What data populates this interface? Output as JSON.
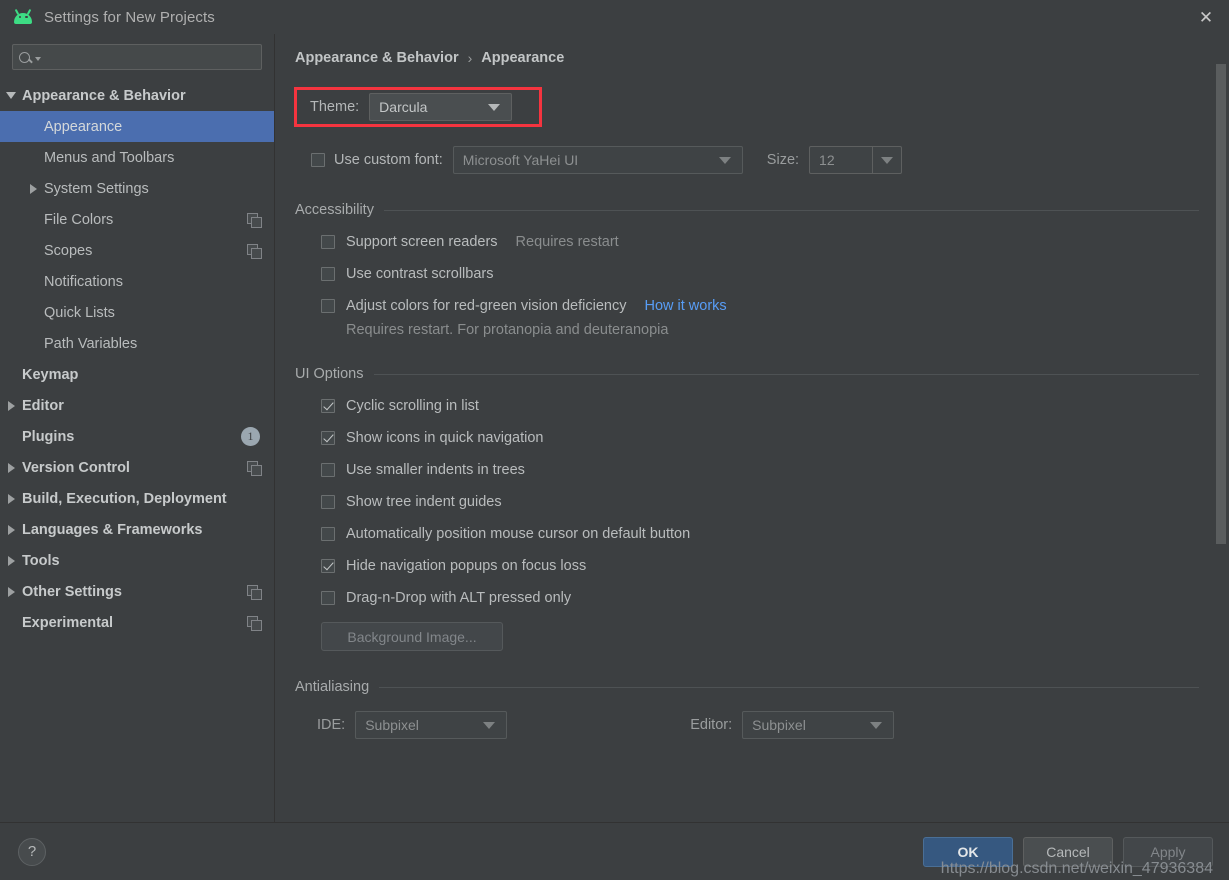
{
  "window": {
    "title": "Settings for New Projects",
    "app_icon": "android-robot-icon",
    "close_icon": "close-icon",
    "accent_selection": "#4b6eaf",
    "annotation_color": "#f5343f",
    "link_color": "#589df6"
  },
  "search": {
    "value": "",
    "placeholder": "",
    "icon": "search-icon"
  },
  "sidebar": {
    "items": [
      {
        "label": "Appearance & Behavior",
        "arrow": "expanded",
        "bold": true,
        "indent": 0,
        "selected": false,
        "icon": "",
        "badge": ""
      },
      {
        "label": "Appearance",
        "arrow": "none",
        "bold": false,
        "indent": 1,
        "selected": true,
        "icon": "",
        "badge": ""
      },
      {
        "label": "Menus and Toolbars",
        "arrow": "none",
        "bold": false,
        "indent": 1,
        "selected": false,
        "icon": "",
        "badge": ""
      },
      {
        "label": "System Settings",
        "arrow": "collapsed",
        "bold": false,
        "indent": 1,
        "selected": false,
        "icon": "",
        "badge": ""
      },
      {
        "label": "File Colors",
        "arrow": "none",
        "bold": false,
        "indent": 1,
        "selected": false,
        "icon": "copy-icon",
        "badge": ""
      },
      {
        "label": "Scopes",
        "arrow": "none",
        "bold": false,
        "indent": 1,
        "selected": false,
        "icon": "copy-icon",
        "badge": ""
      },
      {
        "label": "Notifications",
        "arrow": "none",
        "bold": false,
        "indent": 1,
        "selected": false,
        "icon": "",
        "badge": ""
      },
      {
        "label": "Quick Lists",
        "arrow": "none",
        "bold": false,
        "indent": 1,
        "selected": false,
        "icon": "",
        "badge": ""
      },
      {
        "label": "Path Variables",
        "arrow": "none",
        "bold": false,
        "indent": 1,
        "selected": false,
        "icon": "",
        "badge": ""
      },
      {
        "label": "Keymap",
        "arrow": "none",
        "bold": true,
        "indent": 0,
        "selected": false,
        "icon": "",
        "badge": ""
      },
      {
        "label": "Editor",
        "arrow": "collapsed",
        "bold": true,
        "indent": 0,
        "selected": false,
        "icon": "",
        "badge": ""
      },
      {
        "label": "Plugins",
        "arrow": "none",
        "bold": true,
        "indent": 0,
        "selected": false,
        "icon": "",
        "badge": "1"
      },
      {
        "label": "Version Control",
        "arrow": "collapsed",
        "bold": true,
        "indent": 0,
        "selected": false,
        "icon": "copy-icon",
        "badge": ""
      },
      {
        "label": "Build, Execution, Deployment",
        "arrow": "collapsed",
        "bold": true,
        "indent": 0,
        "selected": false,
        "icon": "",
        "badge": ""
      },
      {
        "label": "Languages & Frameworks",
        "arrow": "collapsed",
        "bold": true,
        "indent": 0,
        "selected": false,
        "icon": "",
        "badge": ""
      },
      {
        "label": "Tools",
        "arrow": "collapsed",
        "bold": true,
        "indent": 0,
        "selected": false,
        "icon": "",
        "badge": ""
      },
      {
        "label": "Other Settings",
        "arrow": "collapsed",
        "bold": true,
        "indent": 0,
        "selected": false,
        "icon": "copy-icon",
        "badge": ""
      },
      {
        "label": "Experimental",
        "arrow": "none",
        "bold": true,
        "indent": 0,
        "selected": false,
        "icon": "copy-icon",
        "badge": ""
      }
    ]
  },
  "breadcrumb": {
    "root": "Appearance & Behavior",
    "separator": "›",
    "current": "Appearance"
  },
  "theme": {
    "label": "Theme:",
    "value": "Darcula",
    "highlighted": true
  },
  "font": {
    "checkbox_label": "Use custom font:",
    "checked": false,
    "value": "Microsoft YaHei UI",
    "size_label": "Size:",
    "size_value": "12",
    "disabled": true
  },
  "accessibility": {
    "title": "Accessibility",
    "options": [
      {
        "label": "Support screen readers",
        "checked": false,
        "note": "Requires restart",
        "link": ""
      },
      {
        "label": "Use contrast scrollbars",
        "checked": false,
        "note": "",
        "link": ""
      },
      {
        "label": "Adjust colors for red-green vision deficiency",
        "checked": false,
        "note": "",
        "link": "How it works"
      }
    ],
    "subnote": "Requires restart. For protanopia and deuteranopia"
  },
  "ui_options": {
    "title": "UI Options",
    "options": [
      {
        "label": "Cyclic scrolling in list",
        "checked": true
      },
      {
        "label": "Show icons in quick navigation",
        "checked": true
      },
      {
        "label": "Use smaller indents in trees",
        "checked": false
      },
      {
        "label": "Show tree indent guides",
        "checked": false
      },
      {
        "label": "Automatically position mouse cursor on default button",
        "checked": false
      },
      {
        "label": "Hide navigation popups on focus loss",
        "checked": true
      },
      {
        "label": "Drag-n-Drop with ALT pressed only",
        "checked": false
      }
    ],
    "background_image_button": "Background Image..."
  },
  "antialiasing": {
    "title": "Antialiasing",
    "ide_label": "IDE:",
    "ide_value": "Subpixel",
    "editor_label": "Editor:",
    "editor_value": "Subpixel"
  },
  "footer": {
    "help": "?",
    "ok": "OK",
    "cancel": "Cancel",
    "apply": "Apply"
  },
  "watermark": "https://blog.csdn.net/weixin_47936384"
}
